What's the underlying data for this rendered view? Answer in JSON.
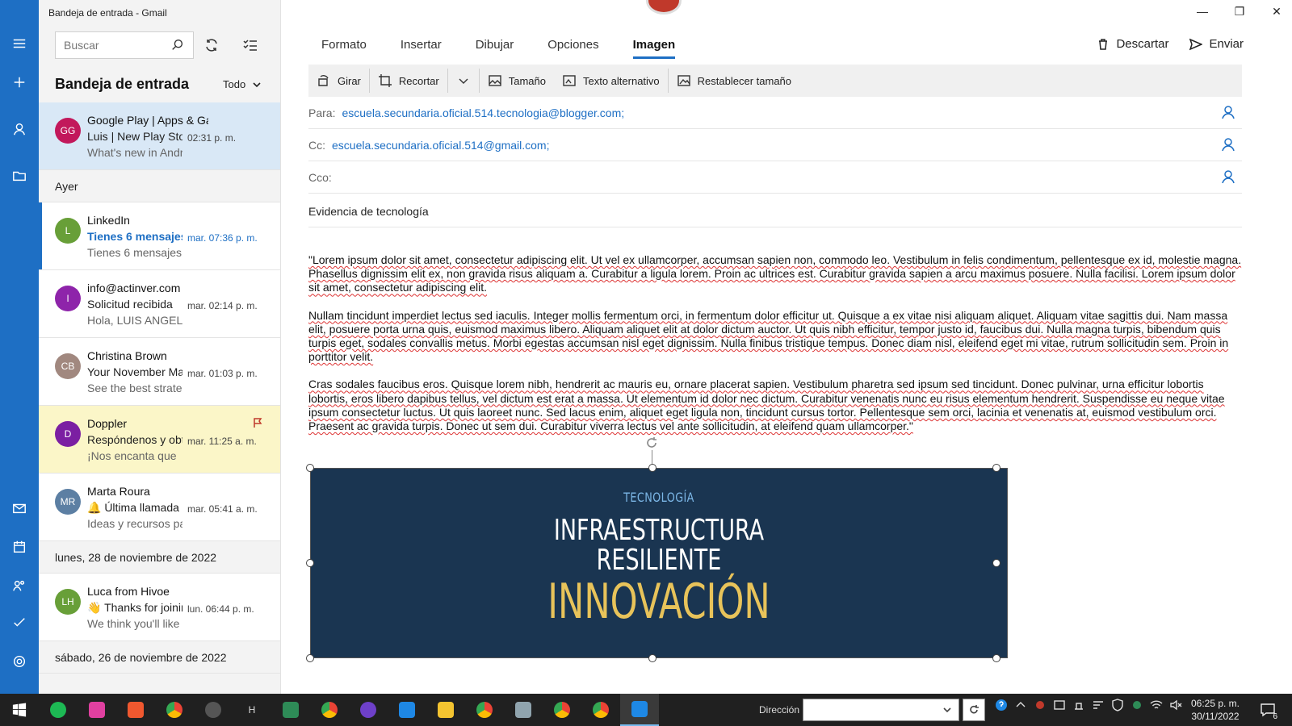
{
  "window": {
    "title": "Bandeja de entrada - Gmail"
  },
  "list": {
    "search_placeholder": "Buscar",
    "title": "Bandeja de entrada",
    "filter": "Todo",
    "messages": [
      {
        "initials": "GG",
        "avatar_color": "#c2185b",
        "from": "Google Play | Apps & Games",
        "subject": "Luis | New Play Store pick",
        "time": "02:31 p. m.",
        "preview": "What's new in Android"
      },
      {
        "initials": "L",
        "avatar_color": "#689f38",
        "from": "LinkedIn",
        "subject": "Tienes 6 mensajes",
        "time": "mar. 07:36 p. m.",
        "preview": "Tienes 6 mensajes"
      },
      {
        "initials": "I",
        "avatar_color": "#8e24aa",
        "from": "info@actinver.com",
        "subject": "Solicitud recibida",
        "time": "mar. 02:14 p. m.",
        "preview": "Hola, LUIS ANGEL"
      },
      {
        "initials": "CB",
        "avatar_color": "#a1887f",
        "from": "Christina Brown",
        "subject": "Your November Marketing",
        "time": "mar. 01:03 p. m.",
        "preview": "See the best strategies"
      },
      {
        "initials": "D",
        "avatar_color": "#7b1fa2",
        "from": "Doppler",
        "subject": "Respóndenos y obtén",
        "time": "mar. 11:25 a. m.",
        "preview": "¡Nos encanta que"
      },
      {
        "initials": "MR",
        "avatar_color": "#5c7fa3",
        "from": "Marta Roura",
        "subject": "🔔 Última llamada",
        "time": "mar. 05:41 a. m.",
        "preview": "Ideas y recursos para"
      },
      {
        "initials": "LH",
        "avatar_color": "#689f38",
        "from": "Luca from Hivoe",
        "subject": "👋 Thanks for joining",
        "time": "lun. 06:44 p. m.",
        "preview": "We think you'll like"
      }
    ],
    "dates": {
      "yesterday": "Ayer",
      "monday": "lunes, 28 de noviembre de 2022",
      "saturday": "sábado, 26 de noviembre de 2022"
    }
  },
  "compose": {
    "tabs": [
      "Formato",
      "Insertar",
      "Dibujar",
      "Opciones",
      "Imagen"
    ],
    "discard": "Descartar",
    "send": "Enviar",
    "ribbon": {
      "rotate": "Girar",
      "crop": "Recortar",
      "size": "Tamaño",
      "alt_text": "Texto alternativo",
      "reset_size": "Restablecer tamaño"
    },
    "to_label": "Para:",
    "to_value": "escuela.secundaria.oficial.514.tecnologia@blogger.com;",
    "cc_label": "Cc:",
    "cc_value": "escuela.secundaria.oficial.514@gmail.com;",
    "bcc_label": "Cco:",
    "subject": "Evidencia de tecnología",
    "body": [
      "\"Lorem ipsum dolor sit amet, consectetur adipiscing elit. Ut vel ex ullamcorper, accumsan sapien non, commodo leo. Vestibulum in felis condimentum, pellentesque ex id, molestie magna. Phasellus dignissim elit ex, non gravida risus aliquam a. Curabitur a ligula lorem. Proin ac ultrices est. Curabitur gravida sapien a arcu maximus posuere. Nulla facilisi. Lorem ipsum dolor sit amet, consectetur adipiscing elit.",
      "Nullam tincidunt imperdiet lectus sed iaculis. Integer mollis fermentum orci, in fermentum dolor efficitur ut. Quisque a ex vitae nisi aliquam aliquet. Aliquam vitae sagittis dui. Nam massa elit, posuere porta urna quis, euismod maximus libero. Aliquam aliquet elit at dolor dictum auctor. Ut quis nibh efficitur, tempor justo id, faucibus dui. Nulla magna turpis, bibendum quis turpis eget, sodales convallis metus. Morbi egestas accumsan nisl eget dignissim. Nulla finibus tristique tempus. Donec diam nisl, eleifend eget mi vitae, rutrum sollicitudin sem. Proin in porttitor velit.",
      "Cras sodales faucibus eros. Quisque lorem nibh, hendrerit ac mauris eu, ornare placerat sapien. Vestibulum pharetra sed ipsum sed tincidunt. Donec pulvinar, urna efficitur lobortis lobortis, eros libero dapibus tellus, vel dictum est erat a massa. Ut elementum id dolor nec dictum. Curabitur venenatis nunc eu risus elementum hendrerit. Suspendisse eu neque vitae ipsum consectetur luctus. Ut quis laoreet nunc. Sed lacus enim, aliquet eget ligula non, tincidunt cursus tortor. Pellentesque sem orci, lacinia et venenatis at, euismod vestibulum orci. Praesent ac gravida turpis. Donec ut sem dui. Curabitur viverra lectus vel ante sollicitudin, at eleifend quam ullamcorper.\""
    ],
    "image": {
      "line1": "TECNOLOGÍA",
      "line2": "INFRAESTRUCTURA",
      "line3": "RESILIENTE",
      "line4": "INNOVACIÓN"
    }
  },
  "taskbar": {
    "address_label": "Dirección",
    "time": "06:25 p. m.",
    "date": "30/11/2022",
    "notification_count": "6",
    "apps": [
      {
        "name": "spotify-icon",
        "color": "#1db954"
      },
      {
        "name": "app-pink-icon",
        "color": "#e040a0"
      },
      {
        "name": "brave-icon",
        "color": "#f0582f"
      },
      {
        "name": "chrome-icon",
        "color": "#4caf50"
      },
      {
        "name": "app-gray-icon",
        "color": "#555555"
      },
      {
        "name": "app-h-icon",
        "color": "#333333"
      },
      {
        "name": "app-green-icon",
        "color": "#2e8b57"
      },
      {
        "name": "chrome-icon-2",
        "color": "#4caf50"
      },
      {
        "name": "github-icon",
        "color": "#6e40c9"
      },
      {
        "name": "vscode-icon",
        "color": "#1e88e5"
      },
      {
        "name": "file-explorer-icon",
        "color": "#f4c430"
      },
      {
        "name": "chrome-icon-3",
        "color": "#4caf50"
      },
      {
        "name": "app-tile-icon",
        "color": "#90a4ae"
      },
      {
        "name": "chrome-icon-4",
        "color": "#4caf50"
      },
      {
        "name": "chrome-icon-5",
        "color": "#4caf50"
      },
      {
        "name": "mail-icon",
        "color": "#1e88e5"
      }
    ]
  }
}
